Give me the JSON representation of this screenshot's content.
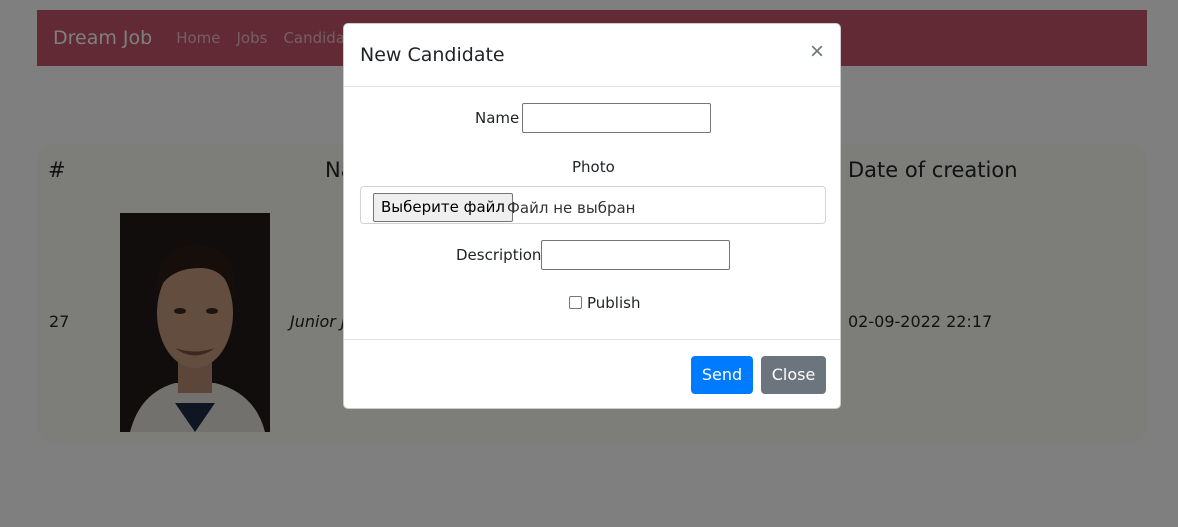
{
  "navbar": {
    "brand": "Dream Job",
    "links": [
      "Home",
      "Jobs",
      "Candidat"
    ]
  },
  "table": {
    "headers": {
      "number": "#",
      "name": "Na",
      "date": "Date of creation"
    },
    "row": {
      "id": "27",
      "name": "Junior J",
      "date": "02-09-2022 22:17"
    }
  },
  "modal": {
    "title": "New Candidate",
    "close_icon": "×",
    "name_label": "Name",
    "name_value": "",
    "photo_label": "Photo",
    "file_button": "Выберите файл",
    "file_status": "Файл не выбран",
    "description_label": "Description",
    "description_value": "",
    "publish_label": "Publish",
    "send_label": "Send",
    "close_label": "Close"
  },
  "colors": {
    "navbar": "#c3546a",
    "primary": "#007bff",
    "secondary": "#6c757d"
  }
}
